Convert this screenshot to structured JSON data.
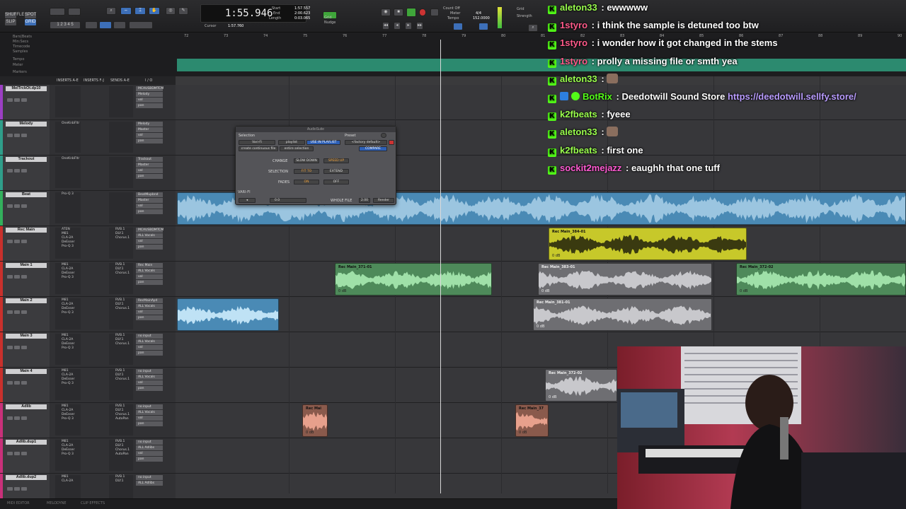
{
  "toolbar": {
    "mode_buttons": [
      "SHUFFLE",
      "SPOT",
      "SLIP",
      "GRID"
    ],
    "counter": "1:55.946",
    "start_label": "Start",
    "end_label": "End",
    "length_label": "Length",
    "start_val": "1:57.557",
    "end_val": "2:00.623",
    "length_val": "0:03.065",
    "cursor_label": "Cursor",
    "cursor_val": "1:57.760",
    "grid_label": "Grid",
    "nudge_label": "Nudge",
    "count_off": "Count Off",
    "meter": "Meter",
    "tempo": "Tempo",
    "tempo_val": "152.0000",
    "meter_val": "4/4",
    "strength": "Strength"
  },
  "ruler": {
    "rows": [
      "Bars|Beats",
      "Min:Secs",
      "Timecode",
      "Samples",
      "Tempo",
      "Meter",
      "Markers"
    ],
    "ticks": [
      "72",
      "73",
      "74",
      "75",
      "76",
      "77",
      "78",
      "79",
      "80",
      "81",
      "82",
      "83",
      "84",
      "85",
      "86",
      "87",
      "88",
      "89",
      "90"
    ]
  },
  "columns": [
    "INSERTS A-E",
    "INSERTS F-J",
    "SENDS A-E",
    "I / O"
  ],
  "tracks": [
    {
      "name": "MelTrckOt.dp10",
      "color": "#9c3fc4",
      "inserts": [],
      "sends": [],
      "io": [
        "MCAUSBDMTCM",
        "Melody",
        "vol",
        "pan"
      ],
      "vol": "0.0"
    },
    {
      "name": "Melody",
      "color": "#2f9e8a",
      "inserts": [
        "OneKnbFltr"
      ],
      "sends": [],
      "io": [
        "Melody",
        "Master",
        "vol",
        "pan"
      ],
      "vol": "-1.0"
    },
    {
      "name": "Trackout",
      "color": "#2f9e8a",
      "inserts": [
        "OneKnbFltr"
      ],
      "sends": [],
      "io": [
        "Trackout",
        "Master",
        "vol",
        "pan"
      ],
      "vol": "-2.0"
    },
    {
      "name": "Beat",
      "color": "#33b05c",
      "inserts": [
        "Pro-Q 3"
      ],
      "sends": [],
      "io": [
        "BeatMupbnd",
        "Master",
        "vol",
        "pan"
      ],
      "vol": "-1.5"
    },
    {
      "name": "Rec Main",
      "color": "#c9302c",
      "inserts": [
        "ATEN",
        "M81",
        "CLA-2A",
        "DeEsser",
        "Pro-Q 3"
      ],
      "sends": [
        "RVB.1",
        "DLY.1",
        "Chorus.1"
      ],
      "io": [
        "MCAUSBDMTCM",
        "ALL Vocals",
        "vol",
        "pan"
      ],
      "vol": "0.0"
    },
    {
      "name": "Main 1",
      "color": "#c9302c",
      "inserts": [
        "M81",
        "CLA-2A",
        "DeEsser",
        "Pro-Q 3"
      ],
      "sends": [
        "RVB.1",
        "DLY.1",
        "Chorus.1"
      ],
      "io": [
        "Rec Main",
        "ALL Vocals",
        "vol",
        "pan"
      ],
      "vol": "0.0"
    },
    {
      "name": "Main 2",
      "color": "#c9302c",
      "inserts": [
        "M81",
        "CLA-2A",
        "DeEsser",
        "Pro-Q 3"
      ],
      "sends": [
        "RVB.1",
        "DLY.1",
        "Chorus.1"
      ],
      "io": [
        "RecMainAyd",
        "ALL Vocals",
        "vol",
        "pan"
      ],
      "vol": "0.0"
    },
    {
      "name": "Main 3",
      "color": "#c9302c",
      "inserts": [
        "M81",
        "CLA-2A",
        "DeEsser",
        "Pro-Q 3"
      ],
      "sends": [
        "RVB.1",
        "DLY.1",
        "Chorus.1"
      ],
      "io": [
        "no input",
        "ALL Vocals",
        "vol",
        "pan"
      ],
      "vol": "0.0"
    },
    {
      "name": "Main 4",
      "color": "#c9302c",
      "inserts": [
        "M81",
        "CLA-2A",
        "DeEsser",
        "Pro-Q 3"
      ],
      "sends": [
        "RVB.1",
        "DLY.1",
        "Chorus.1"
      ],
      "io": [
        "no input",
        "ALL Vocals",
        "vol",
        "pan"
      ],
      "vol": "0.0"
    },
    {
      "name": "Adlib",
      "color": "#c9307a",
      "inserts": [
        "M81",
        "CLA-2A",
        "DeEsser",
        "Pro-Q 3"
      ],
      "sends": [
        "RVB.1",
        "DLY.1",
        "Chorus.1",
        "AutoPan"
      ],
      "io": [
        "no input",
        "ALL Vocals",
        "vol",
        "pan"
      ],
      "vol": "-13.6"
    },
    {
      "name": "Adlib.dup1",
      "color": "#c9307a",
      "inserts": [
        "M81",
        "CLA-2A",
        "DeEsser",
        "Pro-Q 3"
      ],
      "sends": [
        "RVB.1",
        "DLY.1",
        "Chorus.1",
        "AutoPan"
      ],
      "io": [
        "no input",
        "ALL Adlibs",
        "vol",
        "pan"
      ],
      "vol": "0.0"
    },
    {
      "name": "Adlib.dup2",
      "color": "#c9307a",
      "inserts": [
        "M81",
        "CLA-2A"
      ],
      "sends": [
        "RVB.1",
        "DLY.1"
      ],
      "io": [
        "no input",
        "ALL Adlibs"
      ],
      "vol": "0.0"
    }
  ],
  "clips": [
    {
      "name": "Rec Main_384-01",
      "gain": "0 dB",
      "color": "yellow",
      "track": 4,
      "from": 775,
      "to": 1055
    },
    {
      "name": "Rec Main_371-01",
      "gain": "0 dB",
      "color": "green",
      "track": 5,
      "from": 473,
      "to": 695
    },
    {
      "name": "Rec Main_383-01",
      "gain": "0 dB",
      "color": "gray",
      "track": 5,
      "from": 760,
      "to": 1006
    },
    {
      "name": "Rec Main_372-02",
      "gain": "0 dB",
      "color": "green",
      "track": 5,
      "from": 1040,
      "to": 1280
    },
    {
      "name": "",
      "gain": "",
      "color": "blue",
      "track": 6,
      "from": 250,
      "to": 394
    },
    {
      "name": "Rec Main_381-01",
      "gain": "0 dB",
      "color": "gray",
      "track": 6,
      "from": 753,
      "to": 1006
    },
    {
      "name": "Rec Main_372-02",
      "gain": "0 dB",
      "color": "gray",
      "track": 8,
      "from": 770,
      "to": 872
    },
    {
      "name": "Rec Mai",
      "gain": "0 dB",
      "color": "salmon",
      "track": 9,
      "from": 427,
      "to": 463
    },
    {
      "name": "Rec Main_37",
      "gain": "0 dB",
      "color": "salmon",
      "track": 9,
      "from": 728,
      "to": 775
    }
  ],
  "dialog": {
    "title": "AudioSuite",
    "selection": "Selection",
    "preset": "Preset",
    "vari_fi": "Vari-Fi",
    "playlist": "playlist",
    "use_in_playlist": "USE IN PLAYLIST",
    "factory_default": "<factory default>",
    "create_continuous_file": "create continuous file",
    "entire_selection": "entire selection",
    "compare": "COMPARE",
    "change": "CHANGE",
    "slow_down": "SLOW DOWN",
    "speed_up": "SPEED UP",
    "selection_lbl": "SELECTION",
    "fit_to": "FIT TO",
    "extend": "EXTEND",
    "fades": "FADES",
    "on": "ON",
    "off": "OFF",
    "varifi_label": "VARI-FI",
    "handle_val": "0.0",
    "whole_file": "WHOLE FILE",
    "handle_secs": "2.00",
    "render": "Render"
  },
  "chat": [
    {
      "user": "aleton33",
      "color": "#9aff4d",
      "text": "ewwwww",
      "link": ""
    },
    {
      "user": "1styro",
      "color": "#ff5a8a",
      "text": "i think the sample is detuned too btw",
      "link": ""
    },
    {
      "user": "1styro",
      "color": "#ff5a8a",
      "text": "i wonder how it got changed in the stems",
      "link": ""
    },
    {
      "user": "1styro",
      "color": "#ff5a8a",
      "text": "prolly a missing file or smth yea",
      "link": ""
    },
    {
      "user": "aleton33",
      "color": "#9aff4d",
      "text": "",
      "link": "",
      "emote": true
    },
    {
      "user": "BotRix",
      "color": "#53fc18",
      "text": "Deedotwill Sound Store",
      "link": "https://deedotwill.sellfy.store/",
      "bot": true
    },
    {
      "user": "k2fbeats",
      "color": "#9aff4d",
      "text": "fyeee",
      "link": ""
    },
    {
      "user": "aleton33",
      "color": "#9aff4d",
      "text": "",
      "link": "",
      "emote": true
    },
    {
      "user": "k2fbeats",
      "color": "#9aff4d",
      "text": "first one",
      "link": ""
    },
    {
      "user": "sockit2mejazz",
      "color": "#ff5ad2",
      "text": "eaughh that one tuff",
      "link": ""
    }
  ],
  "bottom": {
    "midi_editor": "MIDI EDITOR",
    "melodyne": "MELODYNE",
    "clip_effects": "CLIP EFFECTS"
  },
  "colors": {
    "accent": "#3d6fb8",
    "chat_link": "#b99cff",
    "kick_green": "#53fc18"
  }
}
